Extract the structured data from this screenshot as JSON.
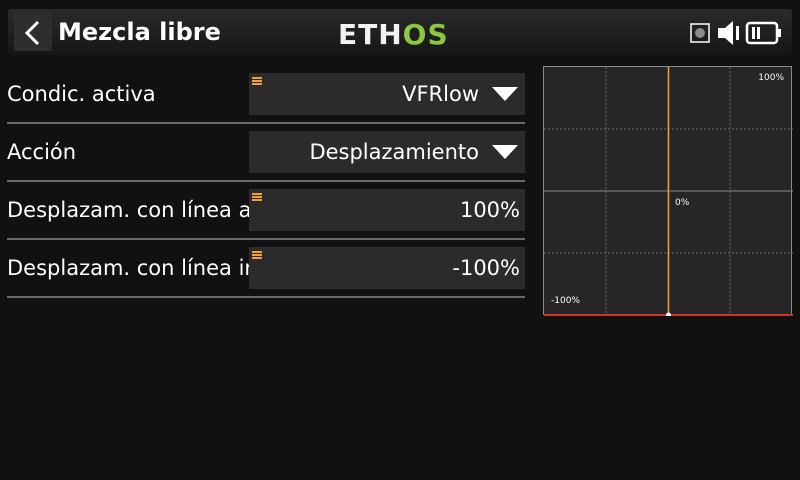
{
  "header": {
    "title": "Mezcla libre",
    "logo_text": "ETHOS",
    "icons": [
      "back-icon",
      "sd-card-icon",
      "volume-icon",
      "battery-icon"
    ]
  },
  "rows": [
    {
      "label": "Condic. activa",
      "value": "VFRlow",
      "type": "dropdown"
    },
    {
      "label": "Acción",
      "value": "Desplazamiento",
      "type": "dropdown"
    },
    {
      "label": "Desplazam. con línea activa",
      "value": "100%",
      "type": "numeric"
    },
    {
      "label": "Desplazam. con línea inactiva",
      "value": "-100%",
      "type": "numeric"
    }
  ],
  "graph": {
    "top_label": "100%",
    "center_label": "0%",
    "bottom_label": "-100%",
    "input_position": 0,
    "output_level": -1,
    "colors": {
      "cursor": "#f0a030",
      "output": "#cc3333",
      "grid": "#6a6a6a"
    }
  },
  "colors": {
    "accent": "#f0a030",
    "logo_green": "#8dc63f",
    "background": "#111111",
    "field": "#2b2b2b"
  }
}
